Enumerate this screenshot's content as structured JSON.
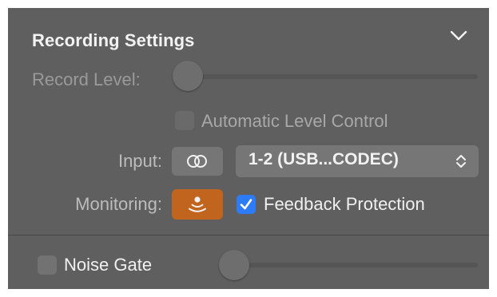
{
  "header": {
    "title": "Recording Settings",
    "collapse_icon": "chevron-down-icon"
  },
  "record_level": {
    "label": "Record Level:",
    "level": 0,
    "enabled": false
  },
  "automatic_level_control": {
    "label": "Automatic Level Control",
    "checked": false,
    "enabled": false
  },
  "input": {
    "label": "Input:",
    "channel_icon": "stereo-rings-icon",
    "selected": "1-2  (USB...CODEC)",
    "stepper_icon": "up-down-chevrons-icon"
  },
  "monitoring": {
    "label": "Monitoring:",
    "monitor_icon": "monitoring-waves-icon",
    "monitor_on": true,
    "feedback_label": "Feedback Protection",
    "feedback_checked": true
  },
  "noise_gate": {
    "label": "Noise Gate",
    "checked": false,
    "level": 0
  },
  "colors": {
    "panel_bg": "#5f5f5f",
    "accent_blue": "#2d7cf6",
    "monitor_orange": "#c1641e"
  }
}
